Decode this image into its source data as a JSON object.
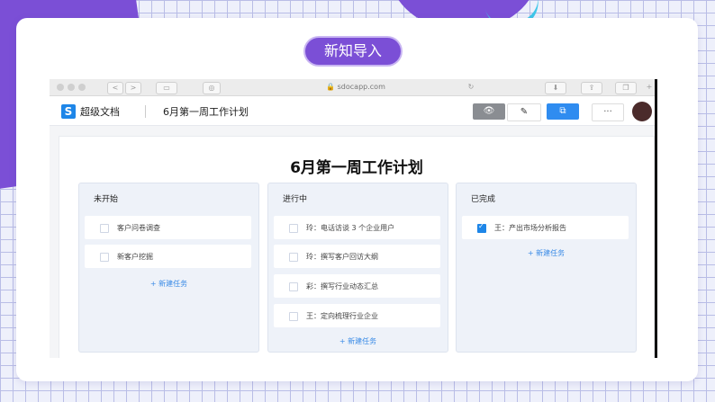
{
  "slide": {
    "title_pill": "新知导入"
  },
  "browser": {
    "url": "sdocapp.com",
    "nav_back": "<",
    "nav_forward": ">"
  },
  "app": {
    "logo": "S",
    "name": "超级文档",
    "doc_title": "6月第一周工作计划",
    "toolbar_more": "···"
  },
  "board": {
    "heading": "6月第一周工作计划",
    "columns": [
      {
        "title": "未开始",
        "cards": [
          {
            "text": "客户问卷调查",
            "checked": false
          },
          {
            "text": "新客户挖掘",
            "checked": false
          }
        ],
        "new_task": "+ 新建任务"
      },
      {
        "title": "进行中",
        "cards": [
          {
            "text": "玲：电话访谈 3 个企业用户",
            "checked": false
          },
          {
            "text": "玲：撰写客户回访大纲",
            "checked": false
          },
          {
            "text": "彩：撰写行业动态汇总",
            "checked": false
          },
          {
            "text": "王：定向梳理行业企业",
            "checked": false
          }
        ],
        "new_task": "+ 新建任务"
      },
      {
        "title": "已完成",
        "cards": [
          {
            "text": "王：产出市场分析报告",
            "checked": true
          }
        ],
        "new_task": "+ 新建任务"
      }
    ]
  },
  "colors": {
    "accent": "#7b4fd6",
    "brand_blue": "#1e86e8",
    "cyan": "#3fc6e8"
  }
}
